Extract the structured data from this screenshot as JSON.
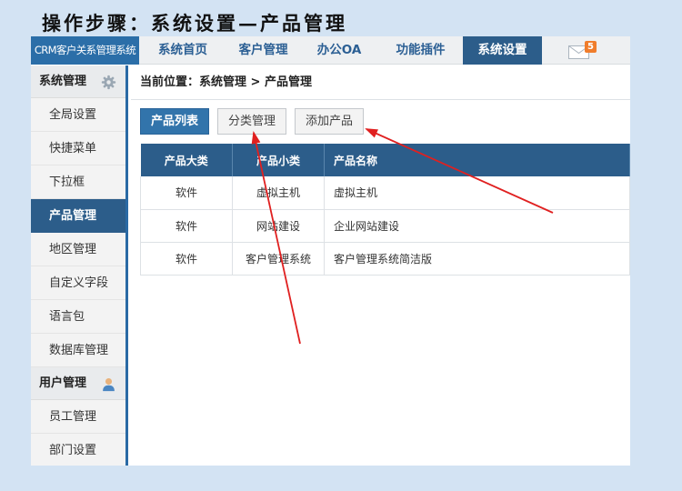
{
  "caption": "操作步骤：系统设置—产品管理",
  "app": {
    "brand": "CRM客户关系管理系统",
    "nav": [
      {
        "label": "系统首页",
        "active": false
      },
      {
        "label": "客户管理",
        "active": false
      },
      {
        "label": "办公OA",
        "active": false
      },
      {
        "label": "功能插件",
        "active": false
      },
      {
        "label": "系统设置",
        "active": true
      }
    ],
    "mail": {
      "icon": "envelope-icon",
      "badge": "5",
      "badge_color": "#f07d2c"
    }
  },
  "sidebar": {
    "groups": [
      {
        "title": "系统管理",
        "icon": "gear-icon",
        "items": [
          {
            "label": "全局设置",
            "active": false
          },
          {
            "label": "快捷菜单",
            "active": false
          },
          {
            "label": "下拉框",
            "active": false
          },
          {
            "label": "产品管理",
            "active": true
          },
          {
            "label": "地区管理",
            "active": false
          },
          {
            "label": "自定义字段",
            "active": false
          },
          {
            "label": "语言包",
            "active": false
          },
          {
            "label": "数据库管理",
            "active": false
          }
        ]
      },
      {
        "title": "用户管理",
        "icon": "user-icon",
        "items": [
          {
            "label": "员工管理",
            "active": false
          },
          {
            "label": "部门设置",
            "active": false
          }
        ]
      }
    ]
  },
  "main": {
    "breadcrumb": "当前位置：系统管理 > 产品管理",
    "buttons": {
      "list": "产品列表",
      "category": "分类管理",
      "add": "添加产品"
    },
    "table": {
      "columns": [
        "产品大类",
        "产品小类",
        "产品名称"
      ],
      "rows": [
        [
          "软件",
          "虚拟主机",
          "虚拟主机"
        ],
        [
          "软件",
          "网站建设",
          "企业网站建设"
        ],
        [
          "软件",
          "客户管理系统",
          "客户管理系统简洁版"
        ]
      ]
    }
  },
  "colors": {
    "accent": "#2c5d8a",
    "brand": "#2b6ea8",
    "annotation_arrow": "#e02020",
    "background": "#d3e3f3"
  }
}
